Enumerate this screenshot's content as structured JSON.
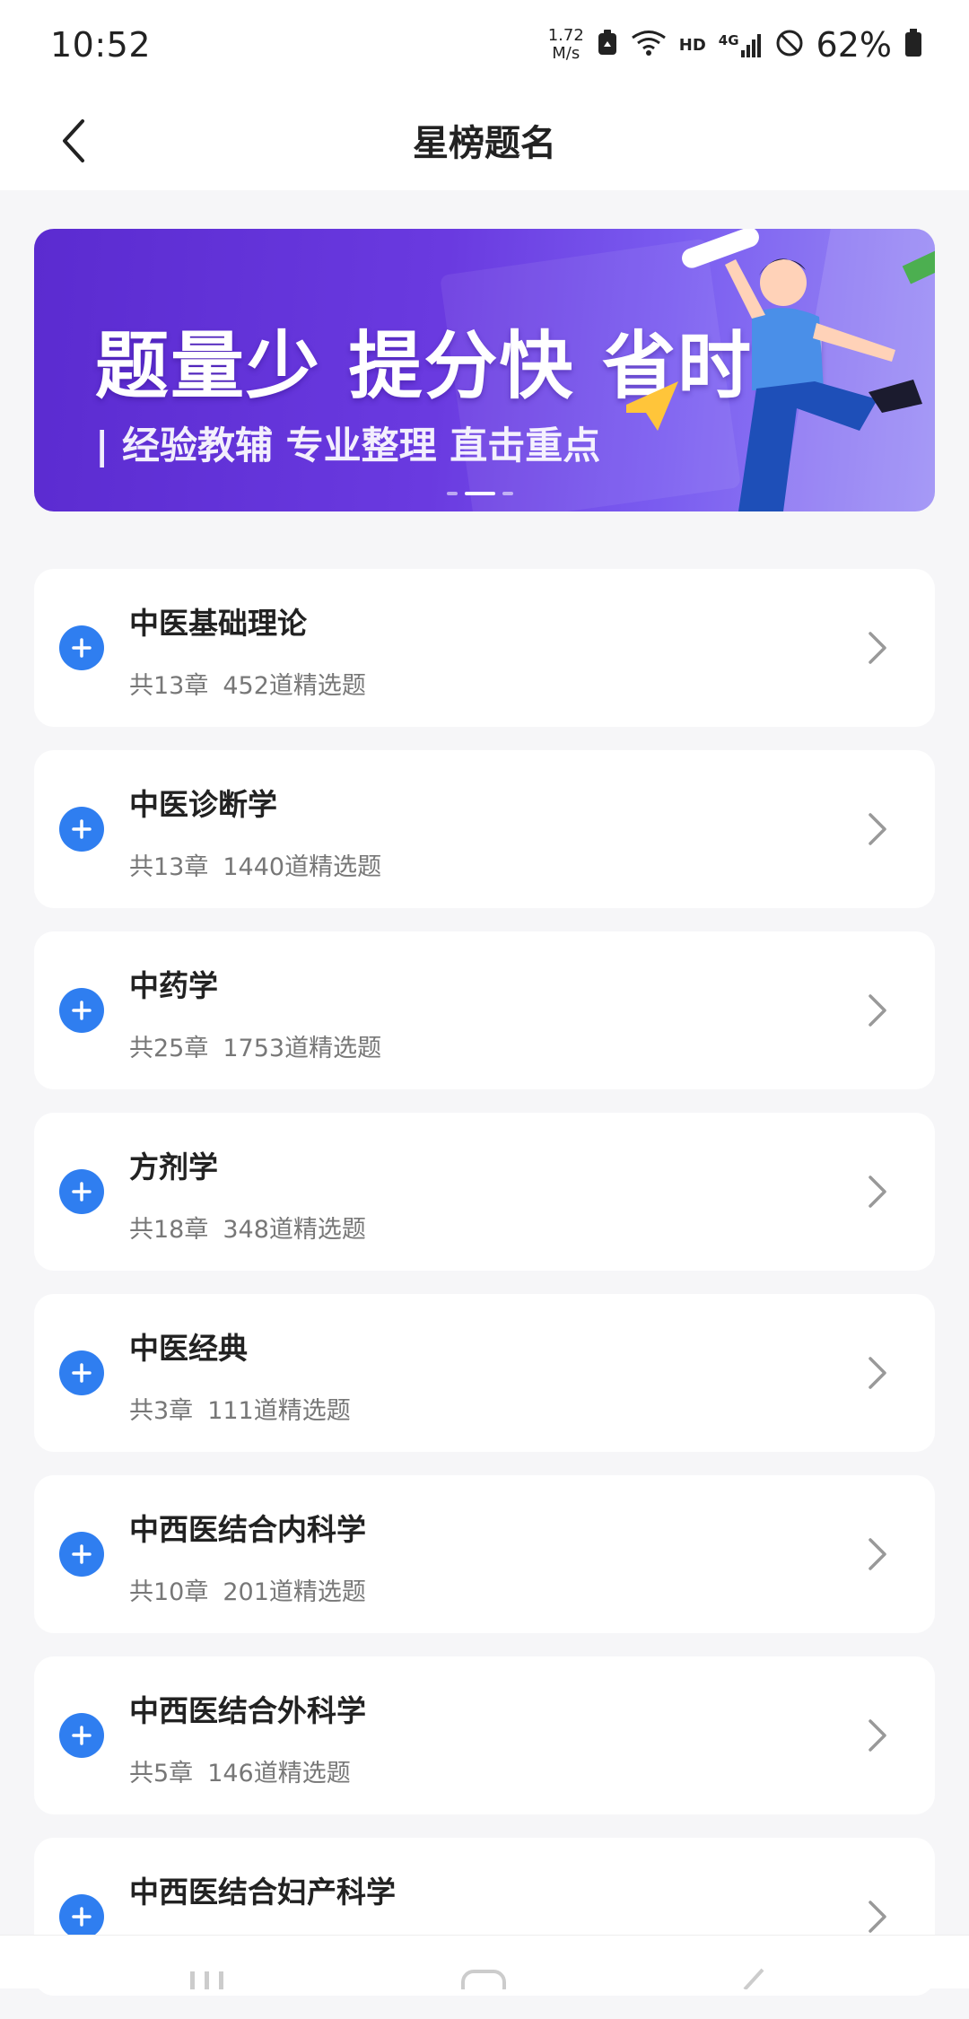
{
  "status_bar": {
    "time": "10:52",
    "net_speed_value": "1.72",
    "net_speed_unit": "M/s",
    "hd": "HD",
    "network": "4G",
    "battery": "62%"
  },
  "header": {
    "title": "星榜题名"
  },
  "banner": {
    "headline": "题量少 提分快 省时间",
    "subtitle": "| 经验教辅 专业整理 直击重点"
  },
  "subjects": [
    {
      "title": "中医基础理论",
      "chapters": "共13章",
      "questions": "452道精选题"
    },
    {
      "title": "中医诊断学",
      "chapters": "共13章",
      "questions": "1440道精选题"
    },
    {
      "title": "中药学",
      "chapters": "共25章",
      "questions": "1753道精选题"
    },
    {
      "title": "方剂学",
      "chapters": "共18章",
      "questions": "348道精选题"
    },
    {
      "title": "中医经典",
      "chapters": "共3章",
      "questions": "111道精选题"
    },
    {
      "title": "中西医结合内科学",
      "chapters": "共10章",
      "questions": "201道精选题"
    },
    {
      "title": "中西医结合外科学",
      "chapters": "共5章",
      "questions": "146道精选题"
    },
    {
      "title": "中西医结合妇产科学",
      "chapters": "",
      "questions": ""
    }
  ],
  "colors": {
    "accent": "#2f7ef0",
    "banner_start": "#5b2bd0",
    "background": "#f6f6f8"
  }
}
